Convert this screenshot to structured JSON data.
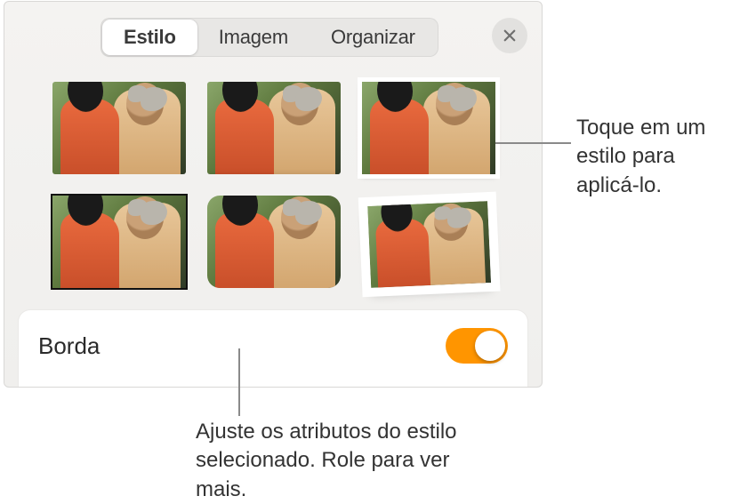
{
  "tabs": {
    "style": "Estilo",
    "image": "Imagem",
    "arrange": "Organizar"
  },
  "section": {
    "border_label": "Borda",
    "border_on": true
  },
  "styles": [
    {
      "name": "plain"
    },
    {
      "name": "reflection"
    },
    {
      "name": "white-border-shadow"
    },
    {
      "name": "black-line"
    },
    {
      "name": "rounded"
    },
    {
      "name": "polaroid-tilted"
    }
  ],
  "callouts": {
    "tap_style": "Toque em um estilo para aplicá-lo.",
    "adjust_attrs": "Ajuste os atributos do estilo selecionado. Role para ver mais."
  },
  "colors": {
    "accent": "#ff9500"
  }
}
